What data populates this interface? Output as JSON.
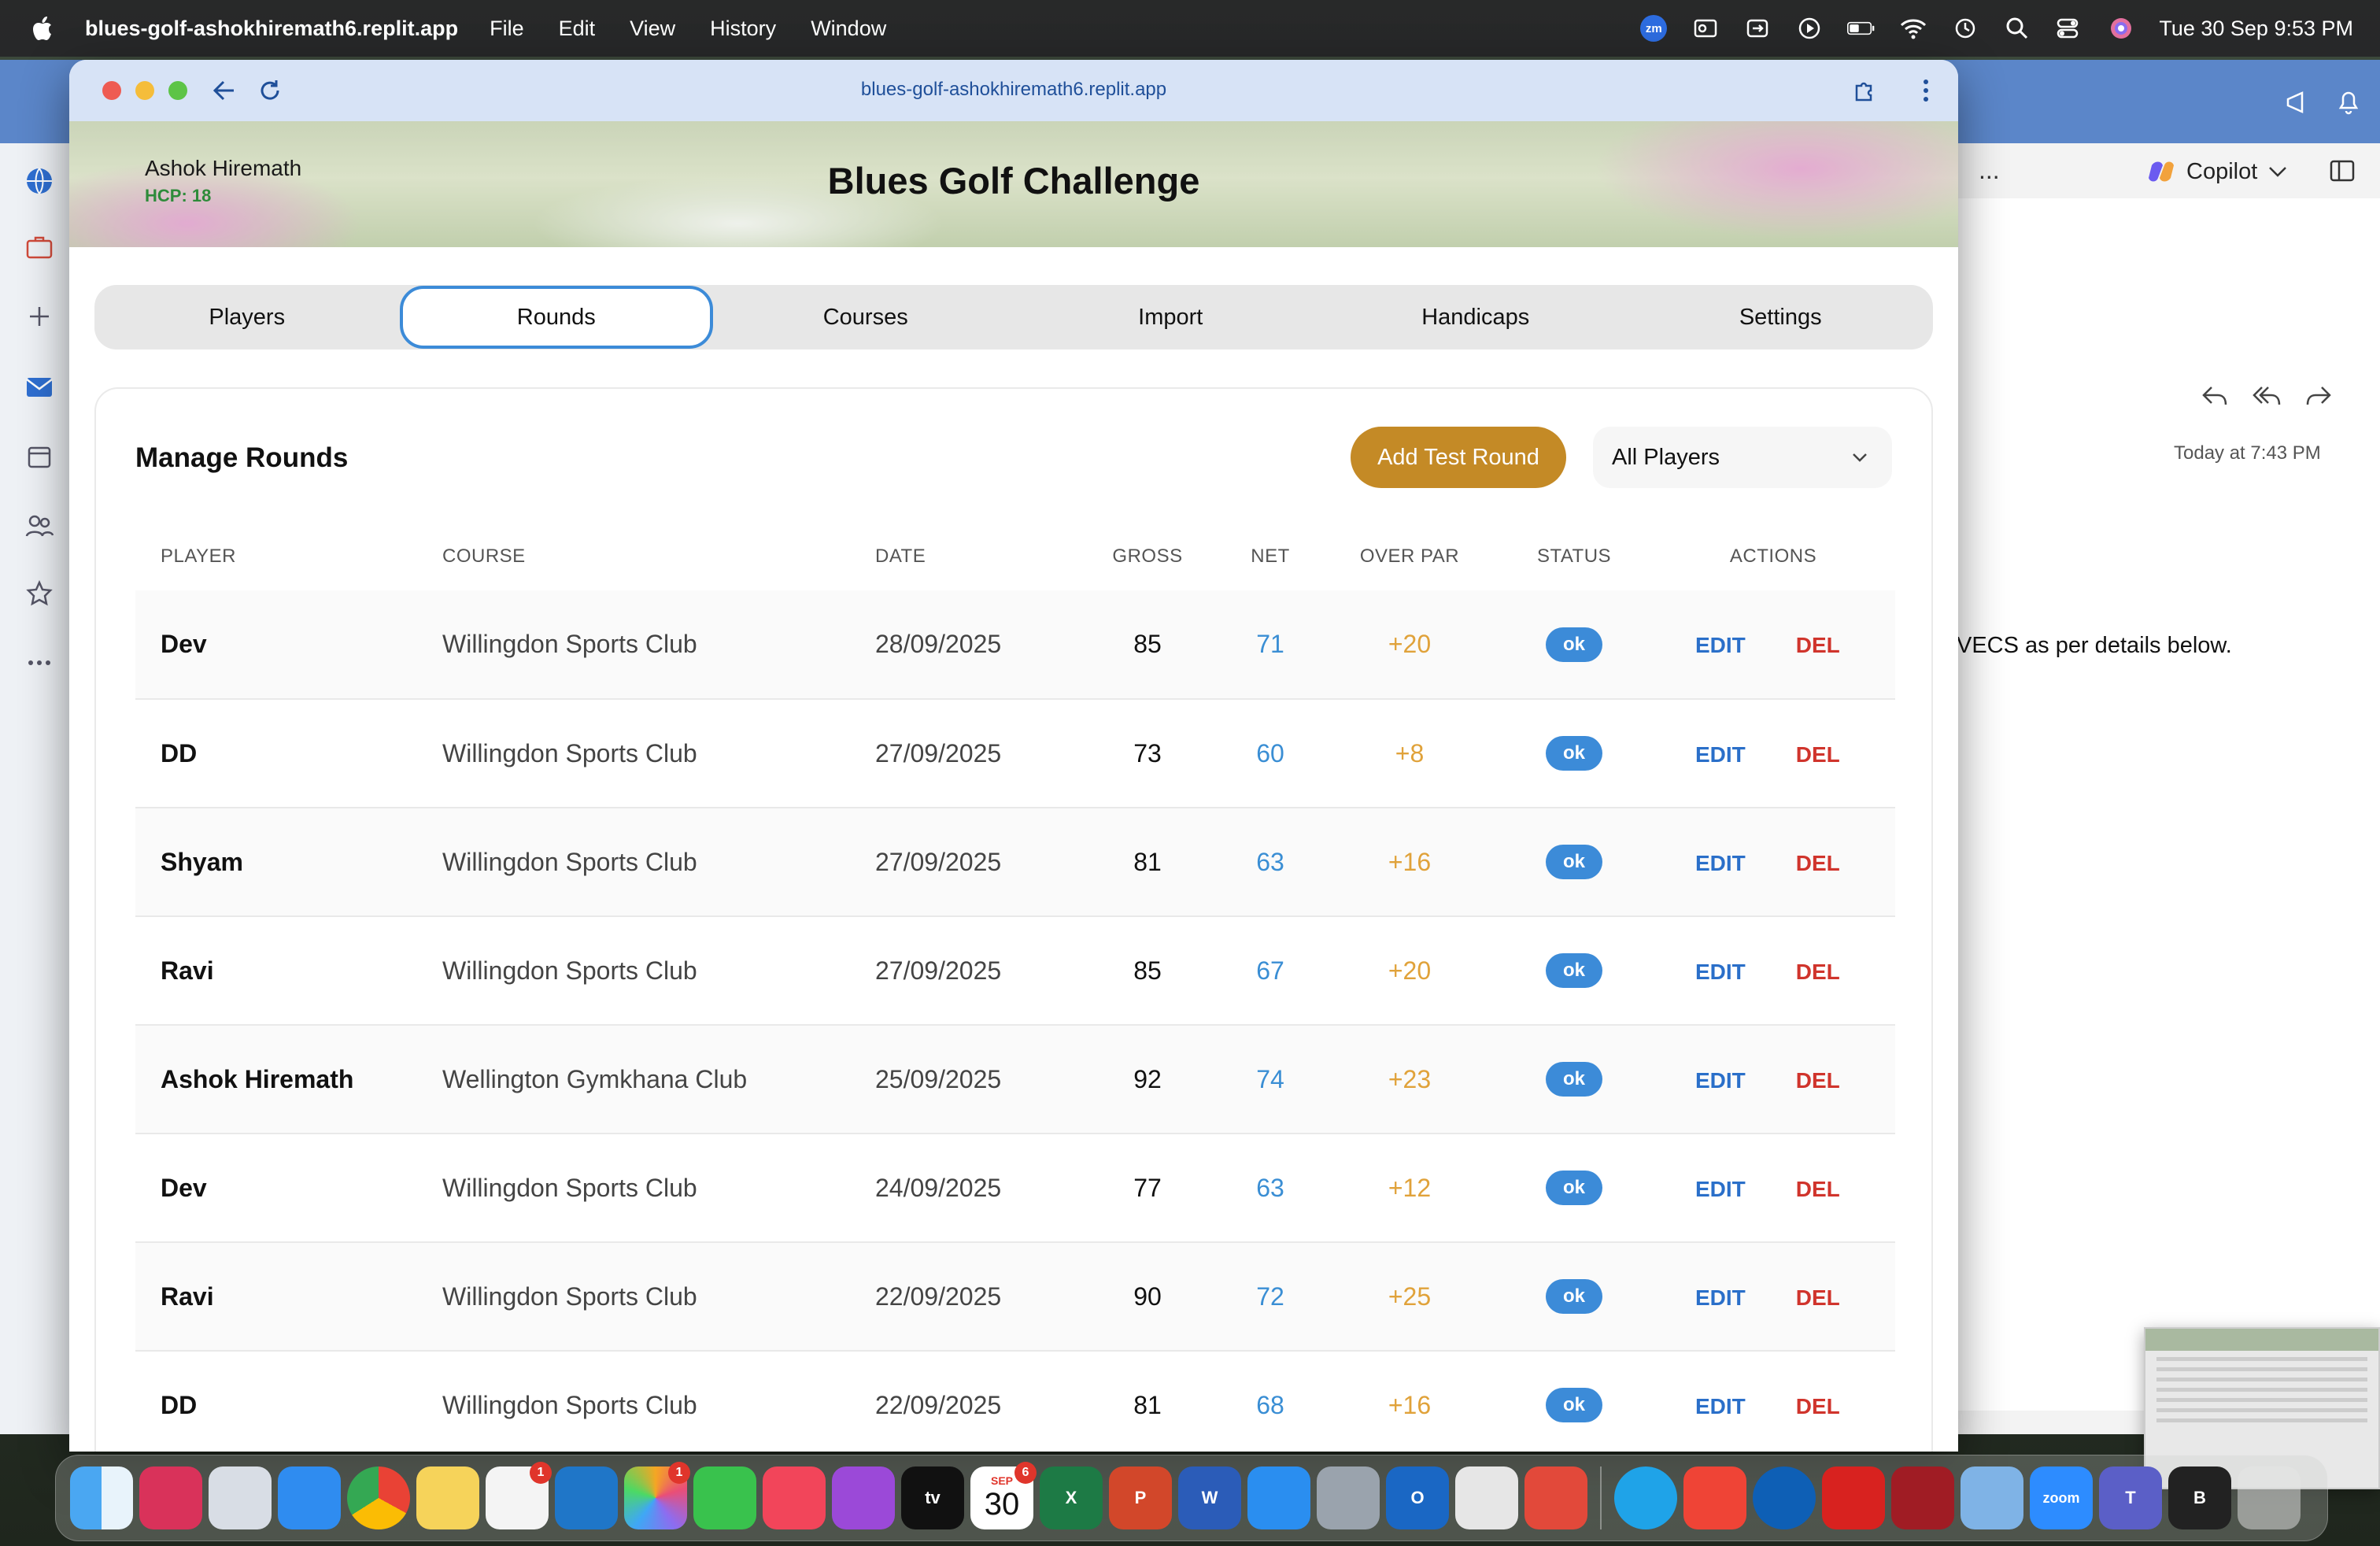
{
  "menubar": {
    "app_name": "blues-golf-ashokhiremath6.replit.app",
    "menus": [
      "File",
      "Edit",
      "View",
      "History",
      "Window"
    ],
    "clock": "Tue 30 Sep  9:53 PM",
    "zoom_label": "zm"
  },
  "browser": {
    "url": "blues-golf-ashokhiremath6.replit.app"
  },
  "header": {
    "user_name": "Ashok Hiremath",
    "handicap": "HCP: 18",
    "title": "Blues Golf Challenge"
  },
  "tabs": [
    {
      "label": "Players",
      "active": false
    },
    {
      "label": "Rounds",
      "active": true
    },
    {
      "label": "Courses",
      "active": false
    },
    {
      "label": "Import",
      "active": false
    },
    {
      "label": "Handicaps",
      "active": false
    },
    {
      "label": "Settings",
      "active": false
    }
  ],
  "rounds": {
    "title": "Manage Rounds",
    "add_button": "Add Test Round",
    "filter_value": "All Players",
    "columns": [
      "PLAYER",
      "COURSE",
      "DATE",
      "GROSS",
      "NET",
      "OVER PAR",
      "STATUS",
      "ACTIONS"
    ],
    "edit_label": "EDIT",
    "delete_label": "DEL",
    "rows": [
      {
        "player": "Dev",
        "course": "Willingdon Sports Club",
        "date": "28/09/2025",
        "gross": "85",
        "net": "71",
        "over": "+20",
        "status": "ok"
      },
      {
        "player": "DD",
        "course": "Willingdon Sports Club",
        "date": "27/09/2025",
        "gross": "73",
        "net": "60",
        "over": "+8",
        "status": "ok"
      },
      {
        "player": "Shyam",
        "course": "Willingdon Sports Club",
        "date": "27/09/2025",
        "gross": "81",
        "net": "63",
        "over": "+16",
        "status": "ok"
      },
      {
        "player": "Ravi",
        "course": "Willingdon Sports Club",
        "date": "27/09/2025",
        "gross": "85",
        "net": "67",
        "over": "+20",
        "status": "ok"
      },
      {
        "player": "Ashok Hiremath",
        "course": "Wellington Gymkhana Club",
        "date": "25/09/2025",
        "gross": "92",
        "net": "74",
        "over": "+23",
        "status": "ok"
      },
      {
        "player": "Dev",
        "course": "Willingdon Sports Club",
        "date": "24/09/2025",
        "gross": "77",
        "net": "63",
        "over": "+12",
        "status": "ok"
      },
      {
        "player": "Ravi",
        "course": "Willingdon Sports Club",
        "date": "22/09/2025",
        "gross": "90",
        "net": "72",
        "over": "+25",
        "status": "ok"
      },
      {
        "player": "DD",
        "course": "Willingdon Sports Club",
        "date": "22/09/2025",
        "gross": "81",
        "net": "68",
        "over": "+16",
        "status": "ok"
      }
    ]
  },
  "outlook": {
    "copilot_label": "Copilot",
    "time": "Today at 7:43 PM",
    "body_fragment": "VECS as per details below.",
    "more_label": "..."
  },
  "dock": {
    "calendar_month": "SEP",
    "calendar_day": "30",
    "reminders_badge": "1",
    "photos_badge": "1",
    "calendar_badge": "6",
    "tv_label": "tv",
    "zoom_label": "zoom",
    "word_label": "W",
    "excel_label": "X",
    "ppt_label": "P",
    "outlook_label": "O",
    "teams_label": "T",
    "b_label": "B"
  },
  "colors": {
    "accent_blue": "#3c8bd8",
    "add_button": "#c48a26",
    "net_blue": "#3a8ed4",
    "over_par": "#e0a23a",
    "delete_red": "#d0342c",
    "hcp_green": "#2e8b3a"
  }
}
